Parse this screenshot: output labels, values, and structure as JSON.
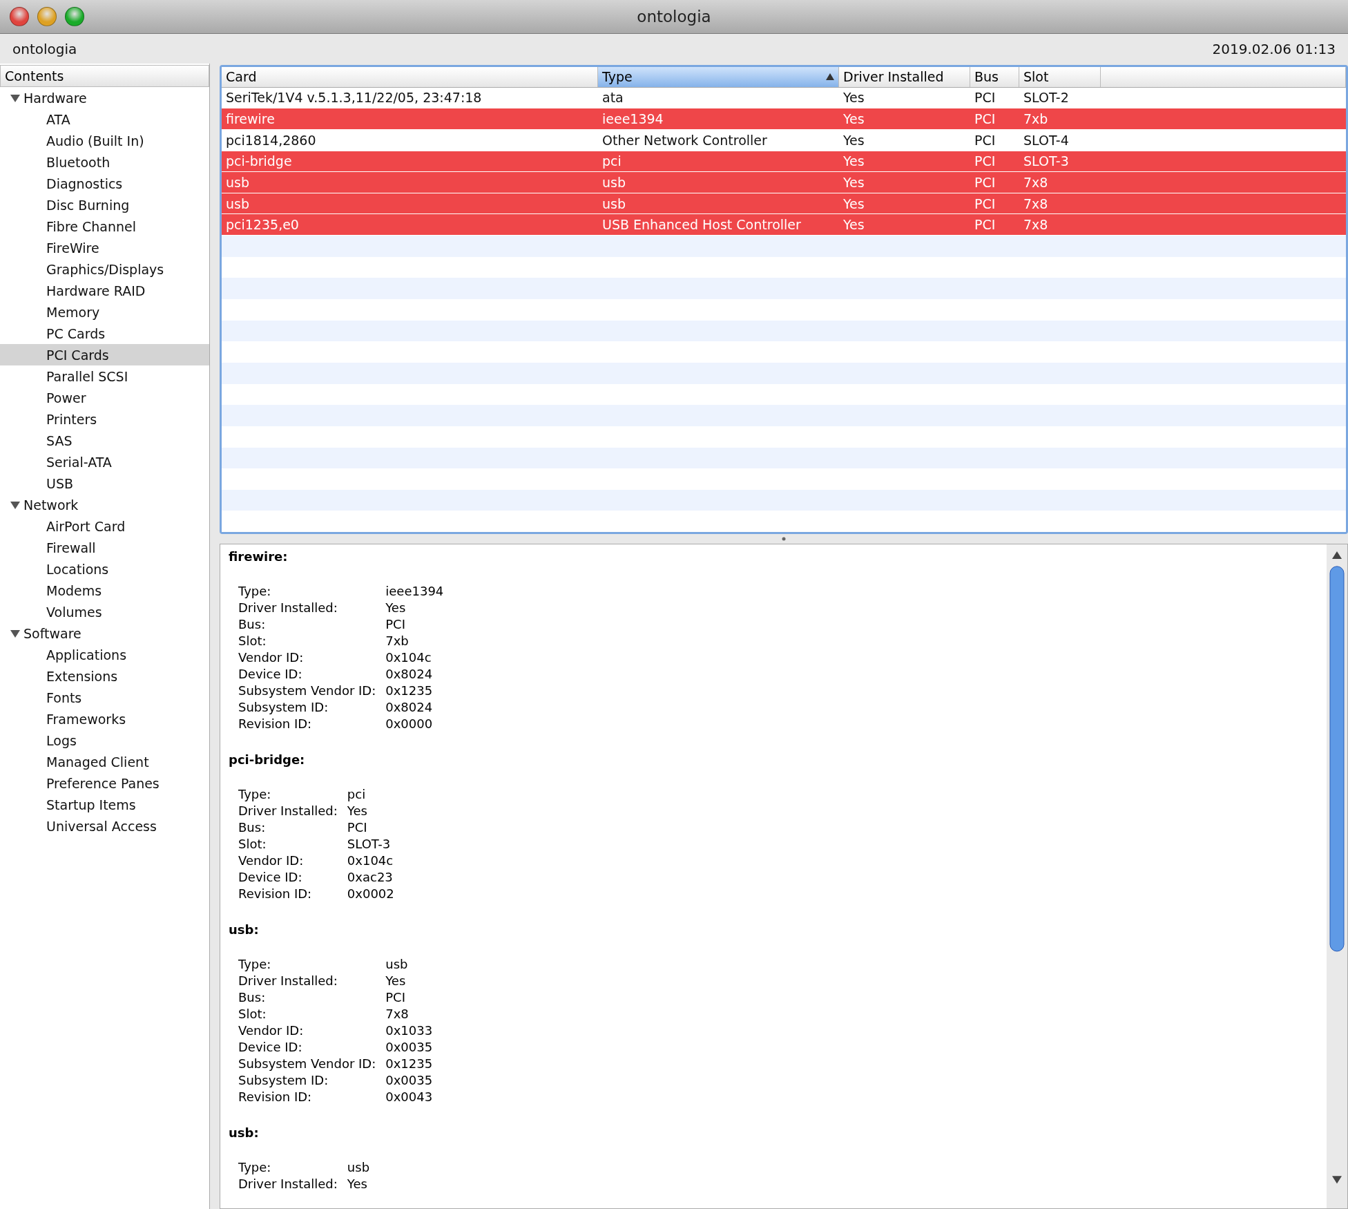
{
  "window": {
    "title": "ontologia"
  },
  "subheader": {
    "machine": "ontologia",
    "timestamp": "2019.02.06 01:13"
  },
  "sidebar": {
    "header": "Contents",
    "items": [
      {
        "label": "Hardware",
        "expanded": true,
        "selected": false,
        "children": [
          {
            "label": "ATA",
            "selected": false
          },
          {
            "label": "Audio (Built In)",
            "selected": false
          },
          {
            "label": "Bluetooth",
            "selected": false
          },
          {
            "label": "Diagnostics",
            "selected": false
          },
          {
            "label": "Disc Burning",
            "selected": false
          },
          {
            "label": "Fibre Channel",
            "selected": false
          },
          {
            "label": "FireWire",
            "selected": false
          },
          {
            "label": "Graphics/Displays",
            "selected": false
          },
          {
            "label": "Hardware RAID",
            "selected": false
          },
          {
            "label": "Memory",
            "selected": false
          },
          {
            "label": "PC Cards",
            "selected": false
          },
          {
            "label": "PCI Cards",
            "selected": true
          },
          {
            "label": "Parallel SCSI",
            "selected": false
          },
          {
            "label": "Power",
            "selected": false
          },
          {
            "label": "Printers",
            "selected": false
          },
          {
            "label": "SAS",
            "selected": false
          },
          {
            "label": "Serial-ATA",
            "selected": false
          },
          {
            "label": "USB",
            "selected": false
          }
        ]
      },
      {
        "label": "Network",
        "expanded": true,
        "selected": false,
        "children": [
          {
            "label": "AirPort Card",
            "selected": false
          },
          {
            "label": "Firewall",
            "selected": false
          },
          {
            "label": "Locations",
            "selected": false
          },
          {
            "label": "Modems",
            "selected": false
          },
          {
            "label": "Volumes",
            "selected": false
          }
        ]
      },
      {
        "label": "Software",
        "expanded": true,
        "selected": false,
        "children": [
          {
            "label": "Applications",
            "selected": false
          },
          {
            "label": "Extensions",
            "selected": false
          },
          {
            "label": "Fonts",
            "selected": false
          },
          {
            "label": "Frameworks",
            "selected": false
          },
          {
            "label": "Logs",
            "selected": false
          },
          {
            "label": "Managed Client",
            "selected": false
          },
          {
            "label": "Preference Panes",
            "selected": false
          },
          {
            "label": "Startup Items",
            "selected": false
          },
          {
            "label": "Universal Access",
            "selected": false
          }
        ]
      }
    ]
  },
  "table": {
    "columns": [
      {
        "label": "Card",
        "sorted": false
      },
      {
        "label": "Type",
        "sorted": true
      },
      {
        "label": "Driver Installed",
        "sorted": false
      },
      {
        "label": "Bus",
        "sorted": false
      },
      {
        "label": "Slot",
        "sorted": false
      }
    ],
    "rows": [
      {
        "cells": [
          "SeriTek/1V4 v.5.1.3,11/22/05, 23:47:18",
          "ata",
          "Yes",
          "PCI",
          "SLOT-2"
        ],
        "selected": false
      },
      {
        "cells": [
          "firewire",
          "ieee1394",
          "Yes",
          "PCI",
          "7xb"
        ],
        "selected": true
      },
      {
        "cells": [
          "pci1814,2860",
          "Other Network Controller",
          "Yes",
          "PCI",
          "SLOT-4"
        ],
        "selected": false
      },
      {
        "cells": [
          "pci-bridge",
          "pci",
          "Yes",
          "PCI",
          "SLOT-3"
        ],
        "selected": true
      },
      {
        "cells": [
          "usb",
          "usb",
          "Yes",
          "PCI",
          "7x8"
        ],
        "selected": true
      },
      {
        "cells": [
          "usb",
          "usb",
          "Yes",
          "PCI",
          "7x8"
        ],
        "selected": true
      },
      {
        "cells": [
          "pci1235,e0",
          "USB Enhanced Host Controller",
          "Yes",
          "PCI",
          "7x8"
        ],
        "selected": true
      }
    ]
  },
  "details": [
    {
      "title": "firewire:",
      "fields": [
        [
          "Type:",
          "ieee1394"
        ],
        [
          "Driver Installed:",
          "Yes"
        ],
        [
          "Bus:",
          "PCI"
        ],
        [
          "Slot:",
          "7xb"
        ],
        [
          "Vendor ID:",
          "0x104c"
        ],
        [
          "Device ID:",
          "0x8024"
        ],
        [
          "Subsystem Vendor ID:",
          "0x1235"
        ],
        [
          "Subsystem ID:",
          "0x8024"
        ],
        [
          "Revision ID:",
          "0x0000"
        ]
      ]
    },
    {
      "title": "pci-bridge:",
      "fields": [
        [
          "Type:",
          "pci"
        ],
        [
          "Driver Installed:",
          "Yes"
        ],
        [
          "Bus:",
          "PCI"
        ],
        [
          "Slot:",
          "SLOT-3"
        ],
        [
          "Vendor ID:",
          "0x104c"
        ],
        [
          "Device ID:",
          "0xac23"
        ],
        [
          "Revision ID:",
          "0x0002"
        ]
      ]
    },
    {
      "title": "usb:",
      "fields": [
        [
          "Type:",
          "usb"
        ],
        [
          "Driver Installed:",
          "Yes"
        ],
        [
          "Bus:",
          "PCI"
        ],
        [
          "Slot:",
          "7x8"
        ],
        [
          "Vendor ID:",
          "0x1033"
        ],
        [
          "Device ID:",
          "0x0035"
        ],
        [
          "Subsystem Vendor ID:",
          "0x1235"
        ],
        [
          "Subsystem ID:",
          "0x0035"
        ],
        [
          "Revision ID:",
          "0x0043"
        ]
      ]
    },
    {
      "title": "usb:",
      "fields": [
        [
          "Type:",
          "usb"
        ],
        [
          "Driver Installed:",
          "Yes"
        ]
      ]
    }
  ]
}
